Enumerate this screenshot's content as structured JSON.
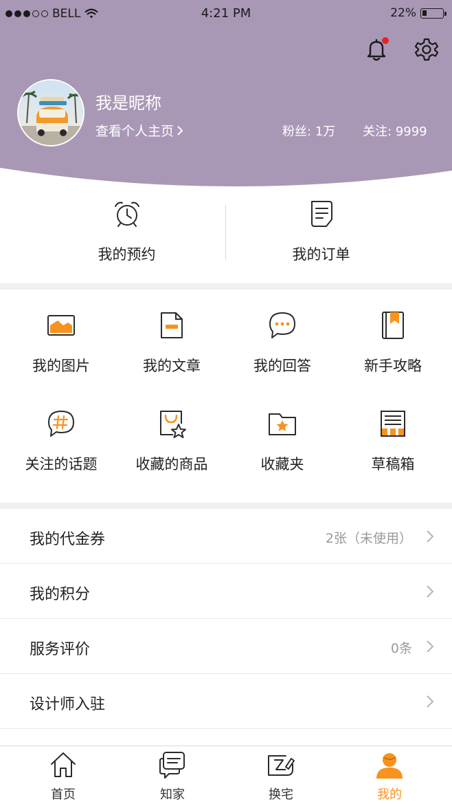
{
  "colors": {
    "header_bg": "#a898b6",
    "accent": "#f7931e",
    "badge": "#e8202a"
  },
  "status_bar": {
    "carrier": "BELL",
    "time": "4:21 PM",
    "battery": "22%"
  },
  "header": {
    "nickname": "我是昵称",
    "profile_link": "查看个人主页",
    "fans": "粉丝: 1万",
    "following": "关注: 9999",
    "icons": [
      "bell-icon",
      "gear-icon"
    ]
  },
  "quick_actions": [
    {
      "label": "我的预约",
      "icon": "alarm-clock-icon"
    },
    {
      "label": "我的订单",
      "icon": "document-icon"
    }
  ],
  "grid": [
    {
      "label": "我的图片",
      "icon": "image-icon"
    },
    {
      "label": "我的文章",
      "icon": "article-icon"
    },
    {
      "label": "我的回答",
      "icon": "chat-bubble-icon"
    },
    {
      "label": "新手攻略",
      "icon": "guide-book-icon"
    },
    {
      "label": "关注的话题",
      "icon": "hashtag-icon"
    },
    {
      "label": "收藏的商品",
      "icon": "favorite-goods-icon"
    },
    {
      "label": "收藏夹",
      "icon": "star-folder-icon"
    },
    {
      "label": "草稿箱",
      "icon": "drafts-icon"
    }
  ],
  "list": [
    {
      "label": "我的代金券",
      "value": "2张（未使用）"
    },
    {
      "label": "我的积分",
      "value": ""
    },
    {
      "label": "服务评价",
      "value": "0条"
    },
    {
      "label": "设计师入驻",
      "value": ""
    }
  ],
  "tabbar": [
    {
      "label": "首页",
      "icon": "home-icon"
    },
    {
      "label": "知家",
      "icon": "message-icon"
    },
    {
      "label": "换宅",
      "icon": "exchange-icon"
    },
    {
      "label": "我的",
      "icon": "user-icon",
      "active": true
    }
  ]
}
